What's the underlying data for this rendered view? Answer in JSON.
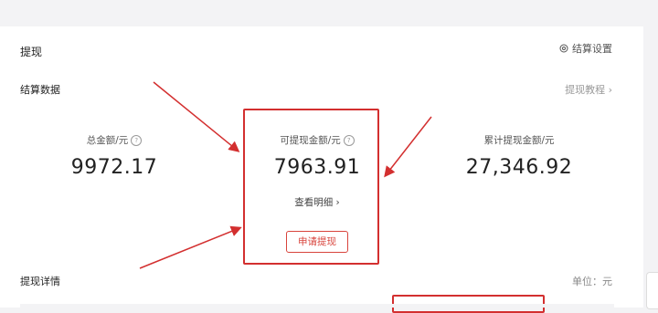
{
  "header": {
    "title": "提现",
    "settings_label": "结算设置"
  },
  "settlement": {
    "section_title": "结算数据",
    "tutorial_link": "提现教程 ›",
    "stats": [
      {
        "label": "总金额/元",
        "value": "9972.17",
        "has_help": true
      },
      {
        "label": "可提现金额/元",
        "value": "7963.91",
        "has_help": true
      },
      {
        "label": "累计提现金额/元",
        "value": "27,346.92",
        "has_help": false
      }
    ],
    "detail_link": "查看明细 ›",
    "apply_button": "申请提现",
    "help_glyph": "?"
  },
  "details": {
    "title": "提现详情",
    "unit": "单位：元"
  },
  "colors": {
    "accent": "#d32f2f",
    "button": "#d8443c",
    "background": "#f3f3f5"
  }
}
